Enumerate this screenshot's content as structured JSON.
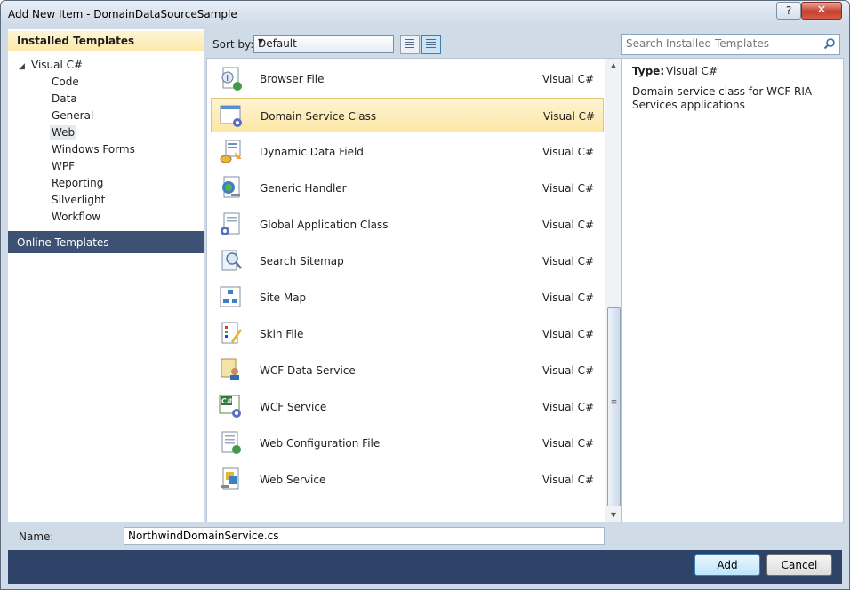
{
  "window": {
    "title": "Add New Item - DomainDataSourceSample",
    "help_label": "?",
    "close_label": "✕"
  },
  "left": {
    "installed_label": "Installed Templates",
    "root": "Visual C#",
    "items": [
      "Code",
      "Data",
      "General",
      "Web",
      "Windows Forms",
      "WPF",
      "Reporting",
      "Silverlight",
      "Workflow"
    ],
    "selected": "Web",
    "online_label": "Online Templates"
  },
  "sort": {
    "label": "Sort by:",
    "value": "Default"
  },
  "search": {
    "placeholder": "Search Installed Templates"
  },
  "templates": [
    {
      "name": "Browser File",
      "lang": "Visual C#",
      "icon": "browser-file-icon"
    },
    {
      "name": "Domain Service Class",
      "lang": "Visual C#",
      "icon": "domain-service-class-icon"
    },
    {
      "name": "Dynamic Data Field",
      "lang": "Visual C#",
      "icon": "dynamic-data-field-icon"
    },
    {
      "name": "Generic Handler",
      "lang": "Visual C#",
      "icon": "generic-handler-icon"
    },
    {
      "name": "Global Application Class",
      "lang": "Visual C#",
      "icon": "global-application-class-icon"
    },
    {
      "name": "Search Sitemap",
      "lang": "Visual C#",
      "icon": "search-sitemap-icon"
    },
    {
      "name": "Site Map",
      "lang": "Visual C#",
      "icon": "site-map-icon"
    },
    {
      "name": "Skin File",
      "lang": "Visual C#",
      "icon": "skin-file-icon"
    },
    {
      "name": "WCF Data Service",
      "lang": "Visual C#",
      "icon": "wcf-data-service-icon"
    },
    {
      "name": "WCF Service",
      "lang": "Visual C#",
      "icon": "wcf-service-icon"
    },
    {
      "name": "Web Configuration File",
      "lang": "Visual C#",
      "icon": "web-configuration-file-icon"
    },
    {
      "name": "Web Service",
      "lang": "Visual C#",
      "icon": "web-service-icon"
    }
  ],
  "selected_template": "Domain Service Class",
  "details": {
    "type_label": "Type:",
    "type_value": "Visual C#",
    "description": "Domain service class for WCF RIA Services applications"
  },
  "name": {
    "label": "Name:",
    "value": "NorthwindDomainService.cs"
  },
  "buttons": {
    "add": "Add",
    "cancel": "Cancel"
  },
  "colors": {
    "accent_header": "#fce9aa",
    "online_header": "#3d5175",
    "footer": "#2f4268",
    "dialog_bg": "#cfdbe7"
  }
}
